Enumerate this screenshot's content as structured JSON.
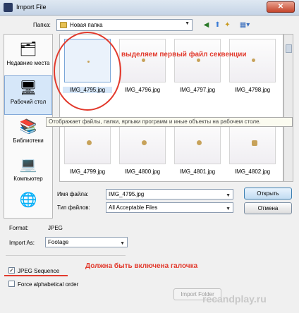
{
  "window": {
    "title": "Import File",
    "close_label": "✕"
  },
  "toolbar": {
    "lookin_label": "Папка:",
    "lookin_value": "Новая папка",
    "back_glyph": "◀",
    "up_glyph": "⬆",
    "newfolder_glyph": "✦",
    "view_glyph": "▦▾"
  },
  "places": [
    {
      "label": "Недавние места",
      "icon": "recent-places-icon",
      "glyph": "🗂"
    },
    {
      "label": "Рабочий стол",
      "icon": "desktop-icon",
      "glyph": "🖥"
    },
    {
      "label": "Библиотеки",
      "icon": "libraries-icon",
      "glyph": "📚"
    },
    {
      "label": "Компьютер",
      "icon": "computer-icon",
      "glyph": "💻"
    },
    {
      "label": "",
      "icon": "network-icon",
      "glyph": "🌐"
    }
  ],
  "files": [
    "IMG_4795.jpg",
    "IMG_4796.jpg",
    "IMG_4797.jpg",
    "IMG_4798.jpg",
    "IMG_4799.jpg",
    "IMG_4800.jpg",
    "IMG_4801.jpg",
    "IMG_4802.jpg"
  ],
  "annotations": {
    "select_first": "выделяем первый файл секвенции",
    "checkbox_note": "Должна быть включена галочка",
    "tooltip": "Отображает файлы, папки, ярлыки программ и иные объекты на рабочем столе."
  },
  "fields": {
    "filename_label": "Имя файла:",
    "filename_value": "IMG_4795.jpg",
    "filetype_label": "Тип файлов:",
    "filetype_value": "All Acceptable Files"
  },
  "buttons": {
    "open": "Открыть",
    "cancel": "Отмена",
    "import_folder": "Import Folder"
  },
  "options": {
    "format_label": "Format:",
    "format_value": "JPEG",
    "import_as_label": "Import As:",
    "import_as_value": "Footage",
    "jpeg_sequence_label": "JPEG Sequence",
    "jpeg_sequence_checked": true,
    "alpha_order_label": "Force alphabetical order",
    "alpha_order_checked": false
  },
  "watermark": "recandplay.ru",
  "colors": {
    "annotation": "#e23a2d",
    "selection": "#d6e7f9"
  }
}
